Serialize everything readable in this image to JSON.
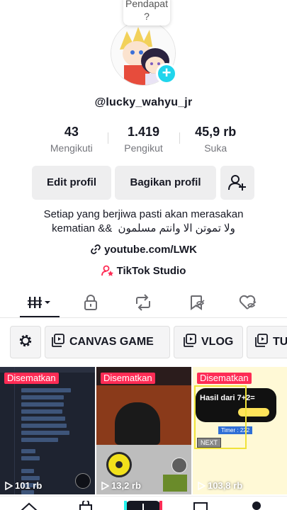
{
  "tooltip": {
    "text": "Pendapat ?"
  },
  "profile": {
    "username": "@lucky_wahyu_jr",
    "avatar_add_label": "+"
  },
  "stats": [
    {
      "value": "43",
      "label": "Mengikuti"
    },
    {
      "value": "1.419",
      "label": "Pengikut"
    },
    {
      "value": "45,9 rb",
      "label": "Suka"
    }
  ],
  "actions": {
    "edit": "Edit profil",
    "share": "Bagikan profil"
  },
  "bio": {
    "line1": "Setiap yang berjiwa pasti akan merasakan",
    "line2_left": "kematian &&",
    "line2_right": "ولا تموتن الا وانتم مسلمون"
  },
  "link": "youtube.com/LWK",
  "studio": "TikTok Studio",
  "tabs": [
    "videos-grid",
    "private",
    "reposts",
    "saved",
    "liked"
  ],
  "playlists": [
    {
      "icon": "settings-gear",
      "label": ""
    },
    {
      "icon": "playlist",
      "label": "CANVAS GAME"
    },
    {
      "icon": "playlist",
      "label": "VLOG"
    },
    {
      "icon": "playlist",
      "label": "TU"
    }
  ],
  "videos": [
    {
      "pinned": "Disematkan",
      "views": "101 rb"
    },
    {
      "pinned": "Disematkan",
      "views": "13,2 rb"
    },
    {
      "pinned": "Disematkan",
      "views": "103,8 rb",
      "quiz_text": "Hasil dari 7+2=",
      "timer": "Timer : 222",
      "next": "NEXT"
    }
  ],
  "colors": {
    "accent": "#fe2c55",
    "badge": "#20d5ec",
    "text": "#161823",
    "secondary": "#75767c"
  }
}
